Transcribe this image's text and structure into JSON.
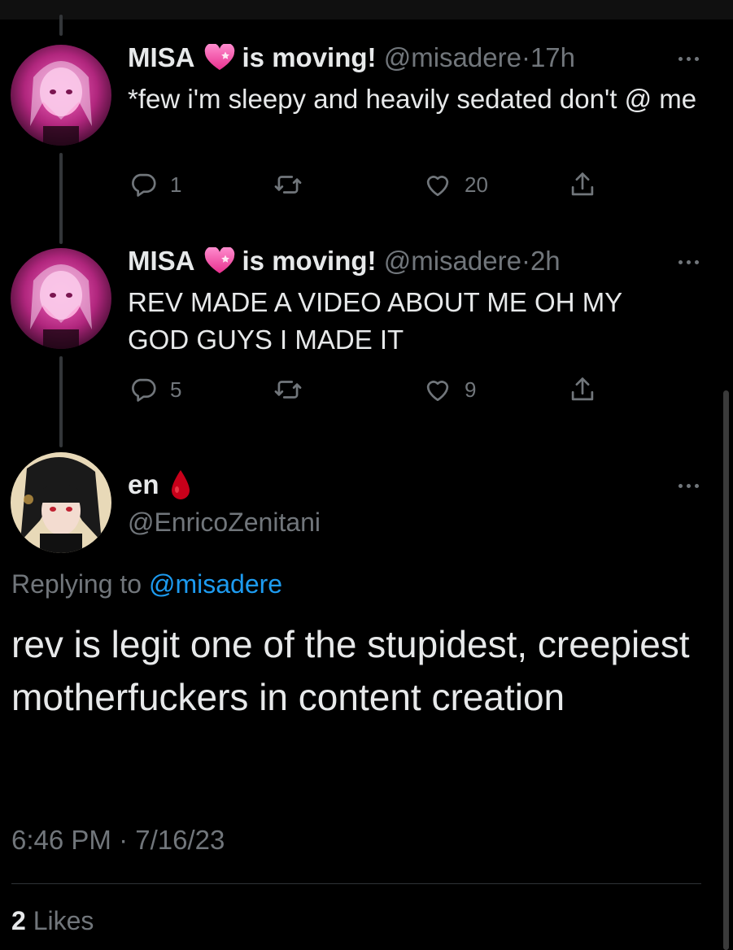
{
  "thread": [
    {
      "display_name": "MISA",
      "name_suffix": "is moving!",
      "handle": "@misadere",
      "separator": "·",
      "time": "17h",
      "text": "*few i'm sleepy and heavily sedated don't @ me",
      "reply_count": "1",
      "retweet_count": "",
      "like_count": "20"
    },
    {
      "display_name": "MISA",
      "name_suffix": "is moving!",
      "handle": "@misadere",
      "separator": "·",
      "time": "2h",
      "text": "REV MADE A VIDEO ABOUT ME OH MY GOD GUYS I MADE IT",
      "reply_count": "5",
      "retweet_count": "",
      "like_count": "9"
    }
  ],
  "reply": {
    "display_name": "en",
    "handle": "@EnricoZenitani",
    "replying_prefix": "Replying to",
    "replying_handle": "@misadere",
    "text": "rev is legit one of the stupidest, creepiest motherfuckers in content creation",
    "timestamp": "6:46 PM · 7/16/23",
    "likes_count": "2",
    "likes_label": "Likes"
  },
  "icons": {
    "reply": "comment-icon",
    "retweet": "retweet-icon",
    "like": "heart-icon",
    "share": "share-icon",
    "more": "more-dots-icon",
    "name_emoji": "pink-heart-emoji",
    "reply_emoji": "blood-drop-emoji"
  },
  "colors": {
    "background": "#000000",
    "text": "#e7e9ea",
    "muted": "#71767b",
    "link": "#1d9bf0",
    "drop": "#c8001a"
  }
}
